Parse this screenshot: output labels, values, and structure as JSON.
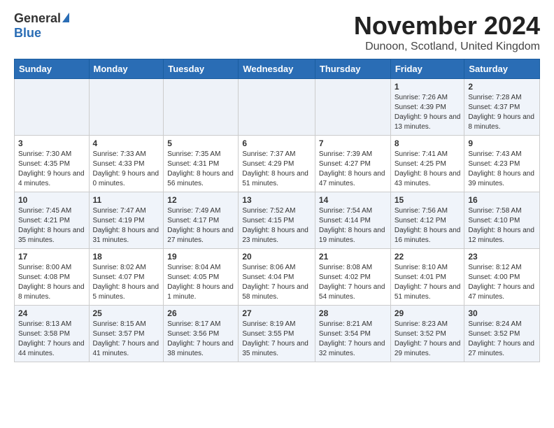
{
  "logo": {
    "general": "General",
    "blue": "Blue"
  },
  "title": "November 2024",
  "subtitle": "Dunoon, Scotland, United Kingdom",
  "days_of_week": [
    "Sunday",
    "Monday",
    "Tuesday",
    "Wednesday",
    "Thursday",
    "Friday",
    "Saturday"
  ],
  "weeks": [
    [
      {
        "day": "",
        "info": ""
      },
      {
        "day": "",
        "info": ""
      },
      {
        "day": "",
        "info": ""
      },
      {
        "day": "",
        "info": ""
      },
      {
        "day": "",
        "info": ""
      },
      {
        "day": "1",
        "info": "Sunrise: 7:26 AM\nSunset: 4:39 PM\nDaylight: 9 hours and 13 minutes."
      },
      {
        "day": "2",
        "info": "Sunrise: 7:28 AM\nSunset: 4:37 PM\nDaylight: 9 hours and 8 minutes."
      }
    ],
    [
      {
        "day": "3",
        "info": "Sunrise: 7:30 AM\nSunset: 4:35 PM\nDaylight: 9 hours and 4 minutes."
      },
      {
        "day": "4",
        "info": "Sunrise: 7:33 AM\nSunset: 4:33 PM\nDaylight: 9 hours and 0 minutes."
      },
      {
        "day": "5",
        "info": "Sunrise: 7:35 AM\nSunset: 4:31 PM\nDaylight: 8 hours and 56 minutes."
      },
      {
        "day": "6",
        "info": "Sunrise: 7:37 AM\nSunset: 4:29 PM\nDaylight: 8 hours and 51 minutes."
      },
      {
        "day": "7",
        "info": "Sunrise: 7:39 AM\nSunset: 4:27 PM\nDaylight: 8 hours and 47 minutes."
      },
      {
        "day": "8",
        "info": "Sunrise: 7:41 AM\nSunset: 4:25 PM\nDaylight: 8 hours and 43 minutes."
      },
      {
        "day": "9",
        "info": "Sunrise: 7:43 AM\nSunset: 4:23 PM\nDaylight: 8 hours and 39 minutes."
      }
    ],
    [
      {
        "day": "10",
        "info": "Sunrise: 7:45 AM\nSunset: 4:21 PM\nDaylight: 8 hours and 35 minutes."
      },
      {
        "day": "11",
        "info": "Sunrise: 7:47 AM\nSunset: 4:19 PM\nDaylight: 8 hours and 31 minutes."
      },
      {
        "day": "12",
        "info": "Sunrise: 7:49 AM\nSunset: 4:17 PM\nDaylight: 8 hours and 27 minutes."
      },
      {
        "day": "13",
        "info": "Sunrise: 7:52 AM\nSunset: 4:15 PM\nDaylight: 8 hours and 23 minutes."
      },
      {
        "day": "14",
        "info": "Sunrise: 7:54 AM\nSunset: 4:14 PM\nDaylight: 8 hours and 19 minutes."
      },
      {
        "day": "15",
        "info": "Sunrise: 7:56 AM\nSunset: 4:12 PM\nDaylight: 8 hours and 16 minutes."
      },
      {
        "day": "16",
        "info": "Sunrise: 7:58 AM\nSunset: 4:10 PM\nDaylight: 8 hours and 12 minutes."
      }
    ],
    [
      {
        "day": "17",
        "info": "Sunrise: 8:00 AM\nSunset: 4:08 PM\nDaylight: 8 hours and 8 minutes."
      },
      {
        "day": "18",
        "info": "Sunrise: 8:02 AM\nSunset: 4:07 PM\nDaylight: 8 hours and 5 minutes."
      },
      {
        "day": "19",
        "info": "Sunrise: 8:04 AM\nSunset: 4:05 PM\nDaylight: 8 hours and 1 minute."
      },
      {
        "day": "20",
        "info": "Sunrise: 8:06 AM\nSunset: 4:04 PM\nDaylight: 7 hours and 58 minutes."
      },
      {
        "day": "21",
        "info": "Sunrise: 8:08 AM\nSunset: 4:02 PM\nDaylight: 7 hours and 54 minutes."
      },
      {
        "day": "22",
        "info": "Sunrise: 8:10 AM\nSunset: 4:01 PM\nDaylight: 7 hours and 51 minutes."
      },
      {
        "day": "23",
        "info": "Sunrise: 8:12 AM\nSunset: 4:00 PM\nDaylight: 7 hours and 47 minutes."
      }
    ],
    [
      {
        "day": "24",
        "info": "Sunrise: 8:13 AM\nSunset: 3:58 PM\nDaylight: 7 hours and 44 minutes."
      },
      {
        "day": "25",
        "info": "Sunrise: 8:15 AM\nSunset: 3:57 PM\nDaylight: 7 hours and 41 minutes."
      },
      {
        "day": "26",
        "info": "Sunrise: 8:17 AM\nSunset: 3:56 PM\nDaylight: 7 hours and 38 minutes."
      },
      {
        "day": "27",
        "info": "Sunrise: 8:19 AM\nSunset: 3:55 PM\nDaylight: 7 hours and 35 minutes."
      },
      {
        "day": "28",
        "info": "Sunrise: 8:21 AM\nSunset: 3:54 PM\nDaylight: 7 hours and 32 minutes."
      },
      {
        "day": "29",
        "info": "Sunrise: 8:23 AM\nSunset: 3:52 PM\nDaylight: 7 hours and 29 minutes."
      },
      {
        "day": "30",
        "info": "Sunrise: 8:24 AM\nSunset: 3:52 PM\nDaylight: 7 hours and 27 minutes."
      }
    ]
  ]
}
